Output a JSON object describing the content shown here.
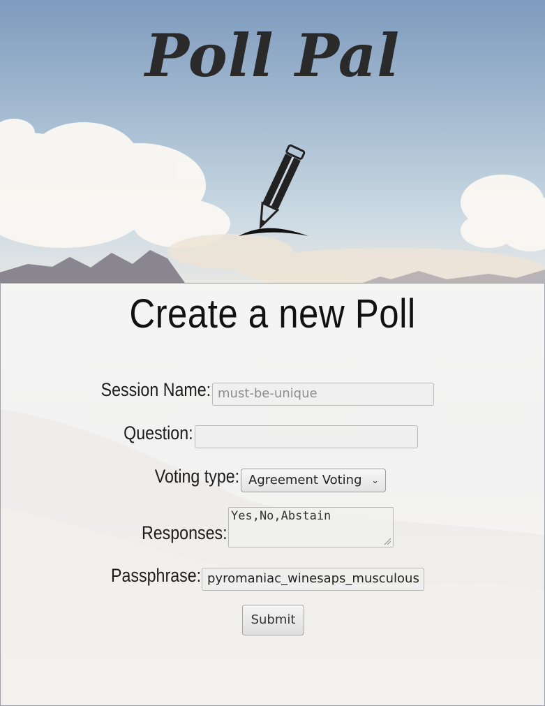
{
  "app": {
    "title": "Poll Pal"
  },
  "form": {
    "heading": "Create a new Poll",
    "session_name": {
      "label": "Session Name:",
      "placeholder": "must-be-unique",
      "value": ""
    },
    "question": {
      "label": "Question:",
      "value": ""
    },
    "voting_type": {
      "label": "Voting type:",
      "selected": "Agreement Voting"
    },
    "responses": {
      "label": "Responses:",
      "value": "Yes,No,Abstain"
    },
    "passphrase": {
      "label": "Passphrase:",
      "value": "pyromaniac_winesaps_musculous"
    },
    "submit_label": "Submit"
  },
  "icons": {
    "logo": "pencil-icon",
    "dropdown": "chevron-down-icon",
    "resize": "resize-grip-icon"
  },
  "colors": {
    "text": "#111111",
    "sky": "#7f9bbe",
    "panel": "#f3f3f3"
  }
}
